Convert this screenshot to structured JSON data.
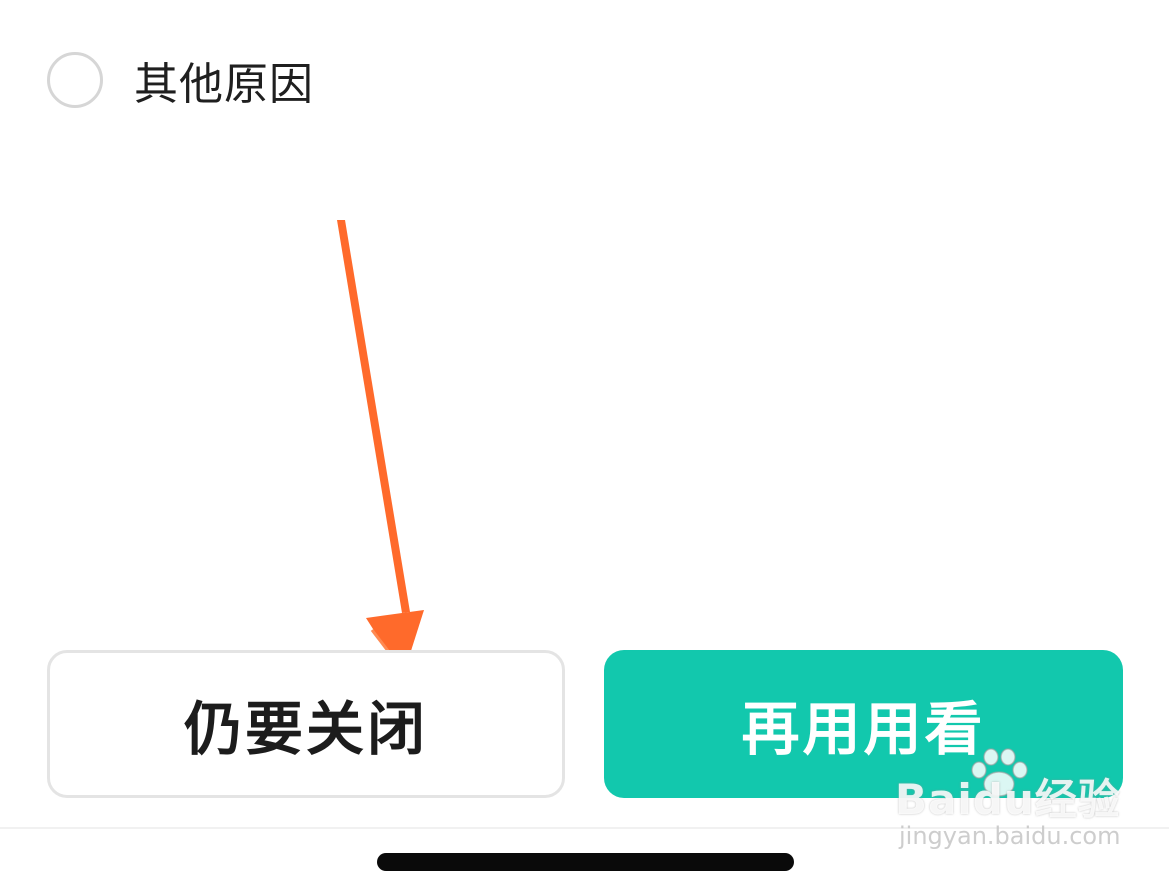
{
  "option": {
    "label": "其他原因",
    "selected": false
  },
  "buttons": {
    "close_label": "仍要关闭",
    "retry_label": "再用用看"
  },
  "watermark": {
    "logo_text": "Baidu经验",
    "url_text": "jingyan.baidu.com"
  },
  "colors": {
    "accent": "#12c8ad",
    "annotation_arrow": "#ff6a2b",
    "radio_border": "#d6d6d6",
    "text_primary": "#1c1c1c"
  }
}
